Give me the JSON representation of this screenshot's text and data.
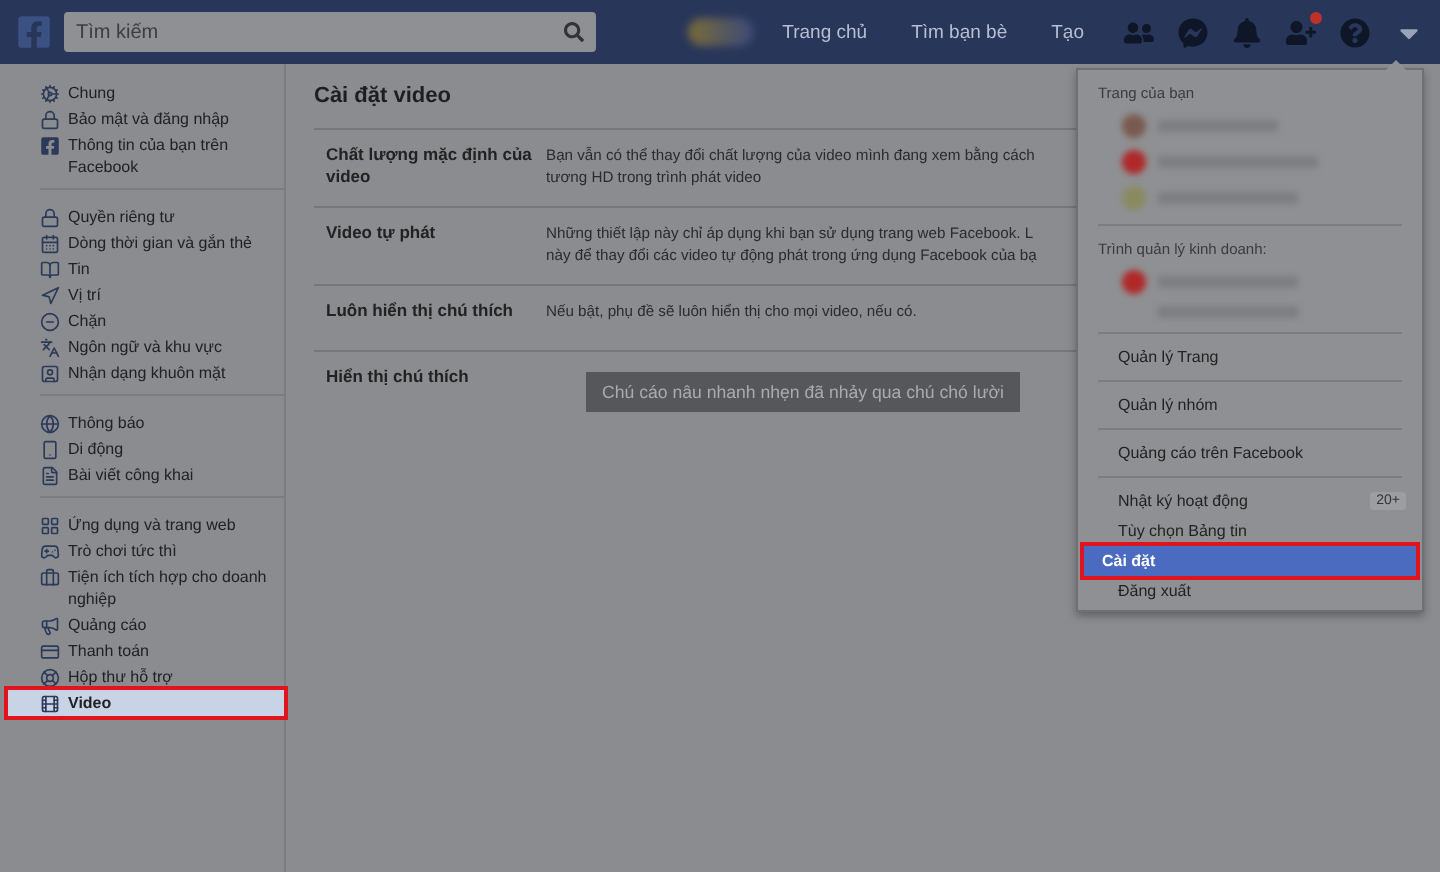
{
  "top_bar": {
    "search": {
      "placeholder": "Tìm kiếm"
    },
    "nav_links": [
      "Trang chủ",
      "Tìm bạn bè",
      "Tạo"
    ],
    "friend_requests_alert": true
  },
  "sidebar": {
    "groups": [
      [
        {
          "label": "Chung",
          "selected": false
        },
        {
          "label": "Bảo mật và đăng nhập",
          "selected": false
        },
        {
          "label": "Thông tin của bạn trên Facebook",
          "selected": false
        }
      ],
      [
        {
          "label": "Quyền riêng tư",
          "selected": false
        },
        {
          "label": "Dòng thời gian và gắn thẻ",
          "selected": false
        },
        {
          "label": "Tin",
          "selected": false
        },
        {
          "label": "Vị trí",
          "selected": false
        },
        {
          "label": "Chặn",
          "selected": false
        },
        {
          "label": "Ngôn ngữ và khu vực",
          "selected": false
        },
        {
          "label": "Nhận dạng khuôn mặt",
          "selected": false
        }
      ],
      [
        {
          "label": "Thông báo",
          "selected": false
        },
        {
          "label": "Di động",
          "selected": false
        },
        {
          "label": "Bài viết công khai",
          "selected": false
        }
      ],
      [
        {
          "label": "Ứng dụng và trang web",
          "selected": false
        },
        {
          "label": "Trò chơi tức thì",
          "selected": false
        },
        {
          "label": "Tiện ích tích hợp cho doanh nghiệp",
          "selected": false
        },
        {
          "label": "Quảng cáo",
          "selected": false
        },
        {
          "label": "Thanh toán",
          "selected": false
        },
        {
          "label": "Hộp thư hỗ trợ",
          "selected": false
        },
        {
          "label": "Video",
          "selected": true
        }
      ]
    ]
  },
  "content": {
    "title": "Cài đặt video",
    "rows": [
      {
        "label": "Chất lượng mặc định của video",
        "description": [
          "Bạn vẫn có thể thay đổi chất lượng của video mình đang xem bằng cách",
          "tương HD trong trình phát video"
        ]
      },
      {
        "label": "Video tự phát",
        "description": [
          "Những thiết lập này chỉ áp dụng khi bạn sử dụng trang web Facebook. L",
          "này để thay đổi các video tự động phát trong ứng dụng Facebook của bạ"
        ]
      },
      {
        "label": "Luôn hiển thị chú thích",
        "description": [
          "Nếu bật, phụ đề sẽ luôn hiển thị cho mọi video, nếu có."
        ]
      },
      {
        "label": "Hiển thị chú thích",
        "caption_preview": "Chú cáo nâu nhanh nhẹn đã nhảy qua chú chó lười"
      }
    ]
  },
  "dropdown": {
    "pages_heading": "Trang của bạn",
    "business_heading": "Trình quản lý kinh doanh:",
    "item_groups": [
      [
        {
          "label": "Quản lý Trang",
          "selected": false
        }
      ],
      [
        {
          "label": "Quản lý nhóm",
          "selected": false
        }
      ],
      [
        {
          "label": "Quảng cáo trên Facebook",
          "selected": false
        }
      ],
      [
        {
          "label": "Nhật ký hoạt động",
          "badge": "20+",
          "selected": false
        },
        {
          "label": "Tùy chọn Bảng tin",
          "selected": false
        },
        {
          "label": "Cài đặt",
          "selected": true
        },
        {
          "label": "Đăng xuất",
          "selected": false
        }
      ]
    ]
  }
}
